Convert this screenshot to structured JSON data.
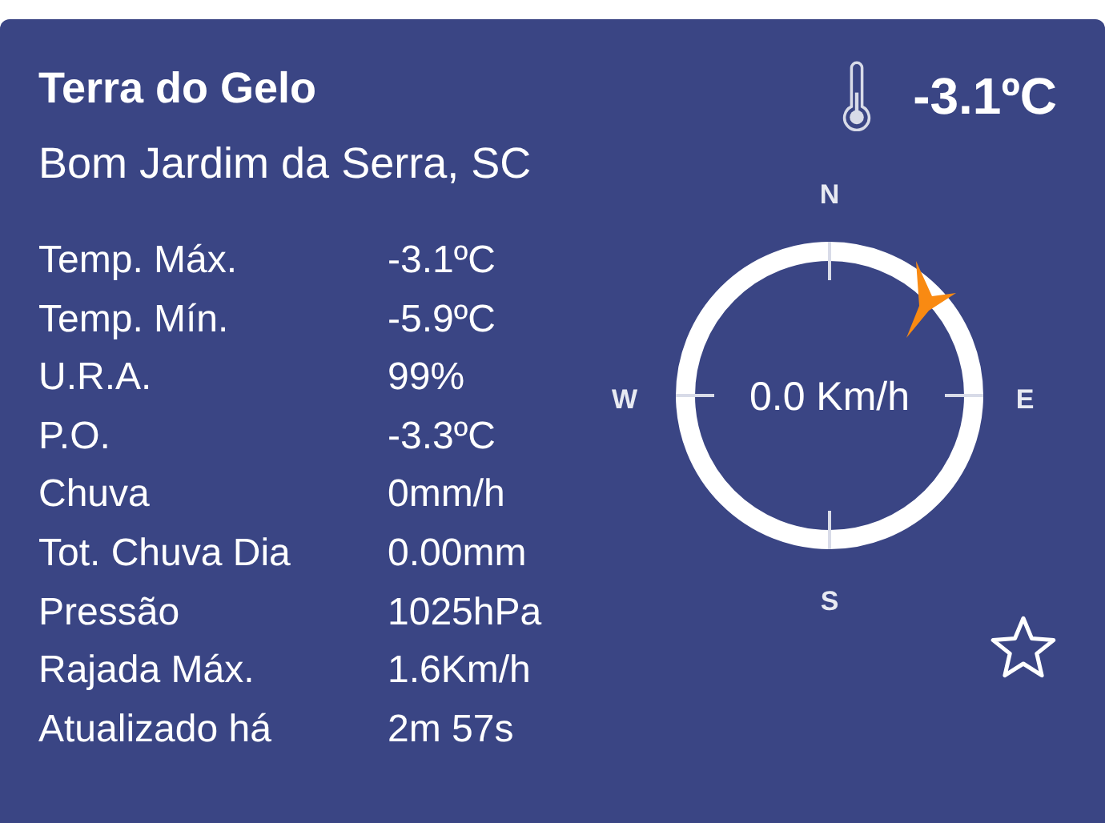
{
  "station": {
    "name": "Terra do Gelo",
    "location": "Bom Jardim da Serra, SC",
    "temperature": "-3.1ºC"
  },
  "readings": [
    {
      "label": "Temp. Máx.",
      "value": "-3.1ºC"
    },
    {
      "label": "Temp. Mín.",
      "value": "-5.9ºC"
    },
    {
      "label": "U.R.A.",
      "value": "99%"
    },
    {
      "label": "P.O.",
      "value": "-3.3ºC"
    },
    {
      "label": "Chuva",
      "value": "0mm/h"
    },
    {
      "label": "Tot. Chuva Dia",
      "value": "0.00mm"
    },
    {
      "label": "Pressão",
      "value": "1025hPa"
    },
    {
      "label": "Rajada Máx.",
      "value": "1.6Km/h"
    },
    {
      "label": "Atualizado há",
      "value": "2m 57s"
    }
  ],
  "wind": {
    "speed": "0.0 Km/h",
    "north": "N",
    "east": "E",
    "south": "S",
    "west": "W"
  },
  "favorite": {
    "on": false
  }
}
